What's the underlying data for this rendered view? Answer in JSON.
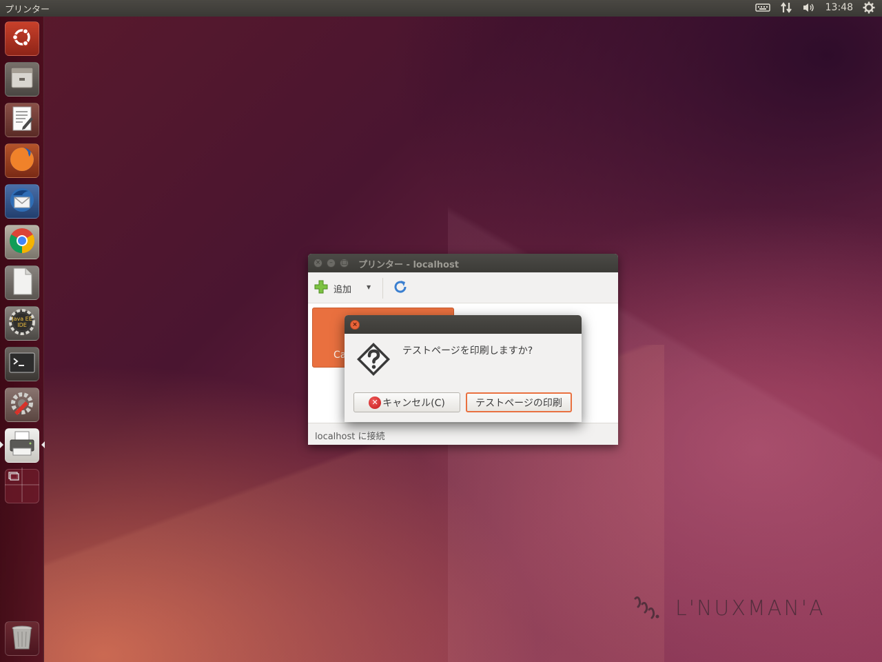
{
  "top_panel": {
    "app_title": "プリンター",
    "clock": "13:48"
  },
  "launcher": {
    "items": [
      {
        "name": "ubuntu-dash",
        "icon": "ubuntu-logo-icon"
      },
      {
        "name": "files",
        "icon": "file-cabinet-icon"
      },
      {
        "name": "text-editor",
        "icon": "text-editor-icon"
      },
      {
        "name": "firefox",
        "icon": "firefox-icon"
      },
      {
        "name": "thunderbird",
        "icon": "thunderbird-icon"
      },
      {
        "name": "chrome",
        "icon": "chrome-icon"
      },
      {
        "name": "libreoffice",
        "icon": "document-icon"
      },
      {
        "name": "java-ee-ide",
        "icon": "java-ee-ide-icon",
        "label": "Java EE IDE"
      },
      {
        "name": "terminal",
        "icon": "terminal-icon"
      },
      {
        "name": "system-settings",
        "icon": "settings-wrench-icon"
      },
      {
        "name": "printers",
        "icon": "printer-icon",
        "active": true
      },
      {
        "name": "workspaces",
        "icon": "workspace-switcher-icon"
      },
      {
        "name": "trash",
        "icon": "trash-icon"
      }
    ]
  },
  "printer_window": {
    "title": "プリンター - localhost",
    "toolbar": {
      "add_label": "追加"
    },
    "printer_tile_label": "Ca",
    "status": "localhost に接続"
  },
  "dialog": {
    "message": "テストページを印刷しますか?",
    "cancel_label": "キャンセル(C)",
    "print_label": "テストページの印刷"
  },
  "watermark": {
    "text": "L'NUXMAN'A"
  },
  "colors": {
    "accent": "#e9703f",
    "panel": "#3c3b37"
  }
}
